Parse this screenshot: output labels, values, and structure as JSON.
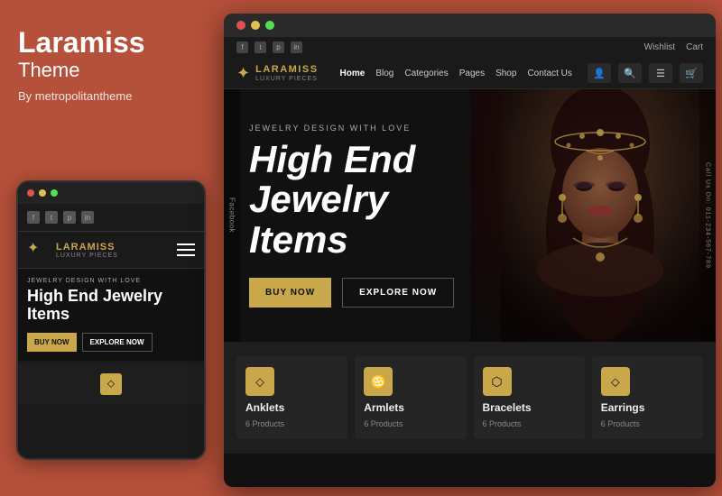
{
  "left": {
    "brand": "Laramiss",
    "theme_label": "Theme",
    "by": "By metropolitantheme"
  },
  "mobile": {
    "hero_label": "JEWELRY DESIGN WITH LOVE",
    "hero_title": "High End Jewelry Items",
    "btn_buy": "BUY NOW",
    "btn_explore": "EXPLORE NOW",
    "logo_name": "LARAMISS",
    "logo_sub": "LUXURY PIECES"
  },
  "desktop": {
    "top_links": [
      "Wishlist",
      "Cart"
    ],
    "social_icons": [
      "f",
      "t",
      "p",
      "in"
    ],
    "logo_name": "LARAMISS",
    "logo_sub": "LUXURY PIECES",
    "nav_links": [
      {
        "label": "Home",
        "active": true
      },
      {
        "label": "Blog",
        "active": false
      },
      {
        "label": "Categories",
        "active": false
      },
      {
        "label": "Pages",
        "active": false
      },
      {
        "label": "Shop",
        "active": false
      },
      {
        "label": "Contact Us",
        "active": false
      }
    ],
    "hero_label": "JEWELRY DESIGN WITH LOVE",
    "hero_title_line1": "High End",
    "hero_title_line2": "Jewelry",
    "hero_title_line3": "Items",
    "btn_buy": "BUY NOW",
    "btn_explore": "EXPLORE NOW",
    "sidebar_text": "Call Us On: 011-234-567-789",
    "categories": [
      {
        "name": "Anklets",
        "count": "6 Products",
        "icon": "⬦"
      },
      {
        "name": "Armlets",
        "count": "6 Products",
        "icon": "♋"
      },
      {
        "name": "Bracelets",
        "count": "6 Products",
        "icon": "⬡"
      },
      {
        "name": "Earrings",
        "count": "6 Products",
        "icon": "⬦"
      }
    ]
  }
}
